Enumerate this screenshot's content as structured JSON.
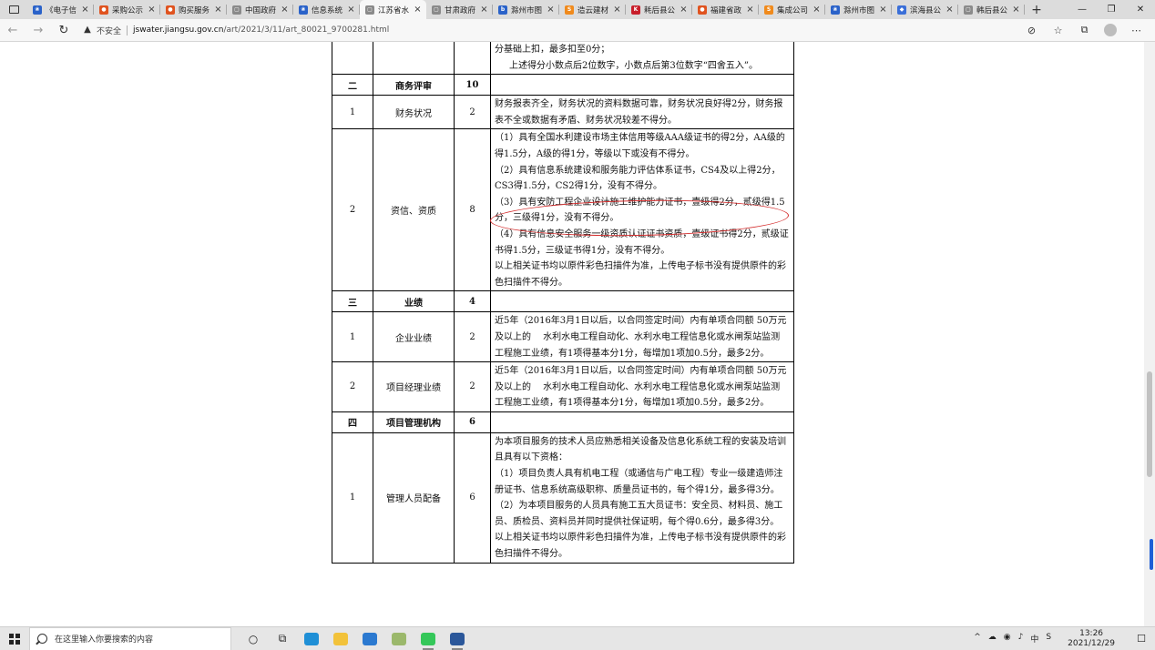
{
  "browser": {
    "tabs": [
      {
        "title": "《电子信",
        "color": "#2a62c9",
        "glyph": "❀"
      },
      {
        "title": "采购公示",
        "color": "#e0531f",
        "glyph": "●"
      },
      {
        "title": "购买服务",
        "color": "#e0531f",
        "glyph": "●"
      },
      {
        "title": "中国政府",
        "color": "#8a8a8a",
        "glyph": "▢"
      },
      {
        "title": "信息系统",
        "color": "#2a62c9",
        "glyph": "❀"
      },
      {
        "title": "江苏省水",
        "color": "#8a8a8a",
        "glyph": "▢",
        "active": true
      },
      {
        "title": "甘肃政府",
        "color": "#8a8a8a",
        "glyph": "▢"
      },
      {
        "title": "滁州市图",
        "color": "#2a62c9",
        "glyph": "b"
      },
      {
        "title": "造云建材",
        "color": "#f08a1c",
        "glyph": "S"
      },
      {
        "title": "耗后县公",
        "color": "#c81e2a",
        "glyph": "K"
      },
      {
        "title": "福建省政",
        "color": "#e0531f",
        "glyph": "●"
      },
      {
        "title": "集成公司",
        "color": "#f08a1c",
        "glyph": "S"
      },
      {
        "title": "滁州市图",
        "color": "#2a62c9",
        "glyph": "❀"
      },
      {
        "title": "滨海县公",
        "color": "#3b6fd8",
        "glyph": "◆"
      },
      {
        "title": "韩后县公",
        "color": "#8a8a8a",
        "glyph": "▢"
      }
    ],
    "new_tab": "+",
    "close_glyph": "×",
    "window_controls": {
      "minimize": "—",
      "maximize": "❐",
      "close": "✕"
    }
  },
  "addressbar": {
    "security_label": "不安全",
    "url_host": "jswater.jiangsu.gov.cn",
    "url_path": "/art/2021/3/11/art_80021_9700281.html"
  },
  "table": {
    "top_fragment": {
      "desc_lines": [
        "分基础上扣，最多扣至0分；",
        "上述得分小数点后2位数字，小数点后第3位数字“四舍五入”。"
      ]
    },
    "sections": [
      {
        "no": "二",
        "title": "商务评审",
        "points": "10",
        "rows": [
          {
            "no": "1",
            "item": "财务状况",
            "points": "2",
            "desc": [
              "财务报表齐全，财务状况的资料数据可靠，财务状况良好得2分，财务报表不全或数据有矛盾、财务状况较差不得分。"
            ]
          },
          {
            "no": "2",
            "item": "资信、资质",
            "points": "8",
            "desc": [
              "（1）具有全国水利建设市场主体信用等级AAA级证书的得2分，AA级的得1.5分，A级的得1分，等级以下或没有不得分。",
              "（2）具有信息系统建设和服务能力评估体系证书，CS4及以上得2分，CS3得1.5分，CS2得1分，没有不得分。",
              "（3）具有安防工程企业设计施工维护能力证书，壹级得2分，贰级得1.5分，三级得1分，没有不得分。",
              "（4）具有信息安全服务一级资质认证证书资质，壹级证书得2分，贰级证书得1.5分，三级证书得1分，没有不得分。",
              "以上相关证书均以原件彩色扫描件为准，上传电子标书没有提供原件的彩色扫描件不得分。"
            ]
          }
        ]
      },
      {
        "no": "三",
        "title": "业绩",
        "points": "4",
        "rows": [
          {
            "no": "1",
            "item": "企业业绩",
            "points": "2",
            "desc": [
              "近5年（2016年3月1日以后，以合同签定时间）内有单项合同额 50万元 及以上的　 水利水电工程自动化、水利水电工程信息化或水闸泵站监测　工程施工业绩，有1项得基本分1分，每增加1项加0.5分，最多2分。"
            ]
          },
          {
            "no": "2",
            "item": "项目经理业绩",
            "points": "2",
            "desc": [
              "近5年（2016年3月1日以后，以合同签定时间）内有单项合同额 50万元 及以上的　 水利水电工程自动化、水利水电工程信息化或水闸泵站监测　工程施工业绩，有1项得基本分1分，每增加1项加0.5分，最多2分。"
            ]
          }
        ]
      },
      {
        "no": "四",
        "title": "项目管理机构",
        "points": "6",
        "rows": [
          {
            "no": "1",
            "item": "管理人员配备",
            "points": "6",
            "desc": [
              "为本项目服务的技术人员应熟悉相关设备及信息化系统工程的安装及培训且具有以下资格：",
              "（1）项目负责人具有机电工程（或通信与广电工程）专业一级建造师注册证书、信息系统高级职称、质量员证书的，每个得1分，最多得3分。",
              "（2）为本项目服务的人员具有施工五大员证书：安全员、材料员、施工员、质检员、资料员并同时提供社保证明，每个得0.6分，最多得3分。",
              "以上相关证书均以原件彩色扫描件为准，上传电子标书没有提供原件的彩色扫描件不得分。"
            ]
          }
        ]
      }
    ]
  },
  "taskbar": {
    "search_placeholder": "在这里输入你要搜索的内容",
    "icons": [
      {
        "name": "cortana-icon",
        "glyph": "○"
      },
      {
        "name": "task-view-icon",
        "glyph": "⧉"
      },
      {
        "name": "edge-icon",
        "color": "#1f8fd6"
      },
      {
        "name": "file-explorer-icon",
        "color": "#f2c23a"
      },
      {
        "name": "mail-icon",
        "color": "#2b79d0"
      },
      {
        "name": "paint-icon",
        "color": "#9bb86b"
      },
      {
        "name": "wechat-icon",
        "color": "#34c759"
      },
      {
        "name": "word-icon",
        "color": "#2b579a"
      }
    ],
    "tray_items": [
      "^",
      "☁",
      "◉",
      "♪",
      "中",
      "S"
    ],
    "time": "13:26",
    "date": "2021/12/29",
    "notification": "☐"
  }
}
